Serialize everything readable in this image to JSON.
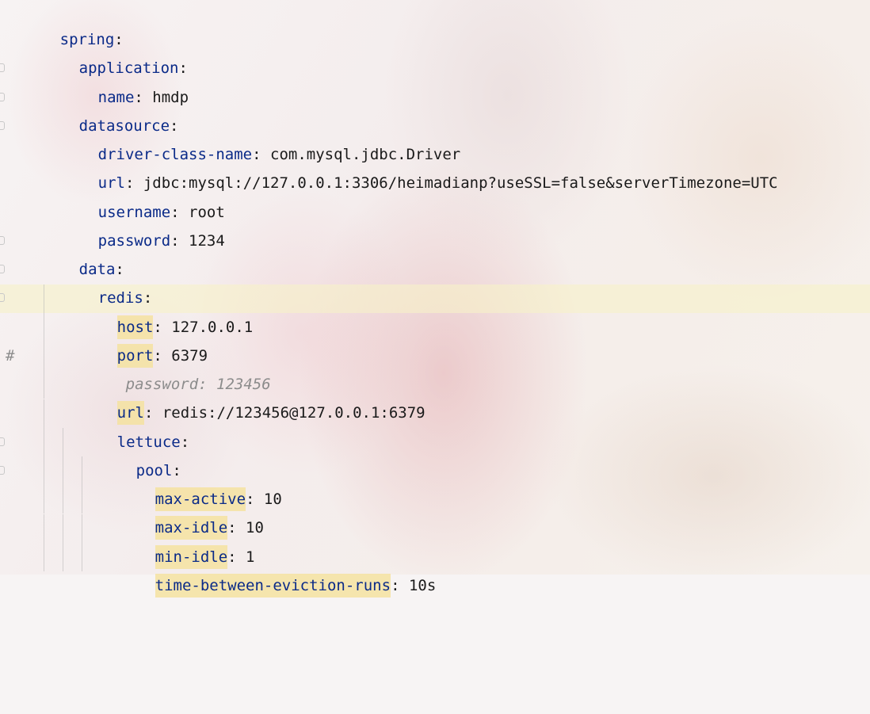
{
  "editor": {
    "lines": [
      {
        "key": "spring",
        "sep": ":",
        "value": ""
      },
      {
        "key": "application",
        "sep": ":",
        "value": ""
      },
      {
        "key": "name",
        "sep": ": ",
        "value": "hmdp"
      },
      {
        "key": "datasource",
        "sep": ":",
        "value": ""
      },
      {
        "key": "driver-class-name",
        "sep": ": ",
        "value": "com.mysql.jdbc.Driver"
      },
      {
        "key": "url",
        "sep": ": ",
        "value": "jdbc:mysql://127.0.0.1:3306/heimadianp?useSSL=false&serverTimezone=UTC"
      },
      {
        "key": "username",
        "sep": ": ",
        "value": "root"
      },
      {
        "key": "password",
        "sep": ": ",
        "value": "1234"
      },
      {
        "key": "data",
        "sep": ":",
        "value": ""
      },
      {
        "key": "redis",
        "sep": ":",
        "value": ""
      },
      {
        "key": "host",
        "sep": ": ",
        "value": "127.0.0.1"
      },
      {
        "key": "port",
        "sep": ": ",
        "value": "6379"
      },
      {
        "comment_marker": "#",
        "comment_text": "password: 123456"
      },
      {
        "key": "url",
        "sep": ": ",
        "value": "redis://123456@127.0.0.1:6379"
      },
      {
        "key": "lettuce",
        "sep": ":",
        "value": ""
      },
      {
        "key": "pool",
        "sep": ":",
        "value": ""
      },
      {
        "key": "max-active",
        "sep": ": ",
        "value": "10"
      },
      {
        "key": "max-idle",
        "sep": ": ",
        "value": "10"
      },
      {
        "key": "min-idle",
        "sep": ": ",
        "value": "1"
      },
      {
        "key": "time-between-eviction-runs",
        "sep": ": ",
        "value": "10s"
      }
    ]
  }
}
